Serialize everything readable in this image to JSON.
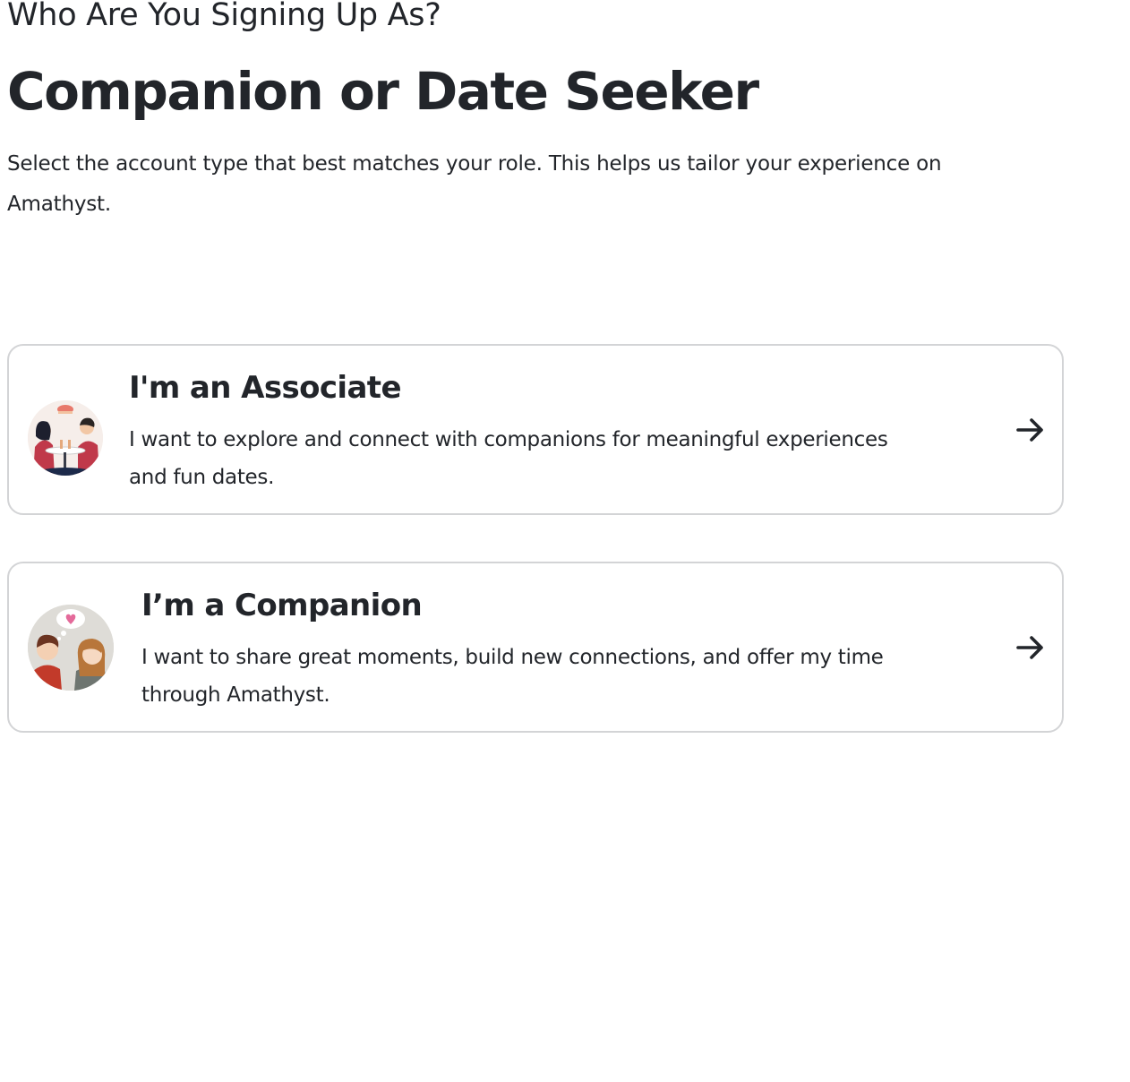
{
  "header": {
    "eyebrow": "Who Are You Signing Up As?",
    "title": "Companion or Date Seeker",
    "subtitle": "Select the account type that best matches your role. This helps us tailor your experience on Amathyst."
  },
  "options": [
    {
      "title": "I'm an Associate",
      "description": "I want to explore and connect with companions for meaningful experiences and fun dates.",
      "icon": "couple-dining-illustration",
      "action_icon": "arrow-right-icon"
    },
    {
      "title": "I’m a Companion",
      "description": "I want to share great moments, build new connections, and offer my time through Amathyst.",
      "icon": "couple-heart-thought-illustration",
      "action_icon": "arrow-right-icon"
    }
  ],
  "colors": {
    "text": "#22252a",
    "card_border": "#d3d4d6",
    "background": "#ffffff"
  }
}
